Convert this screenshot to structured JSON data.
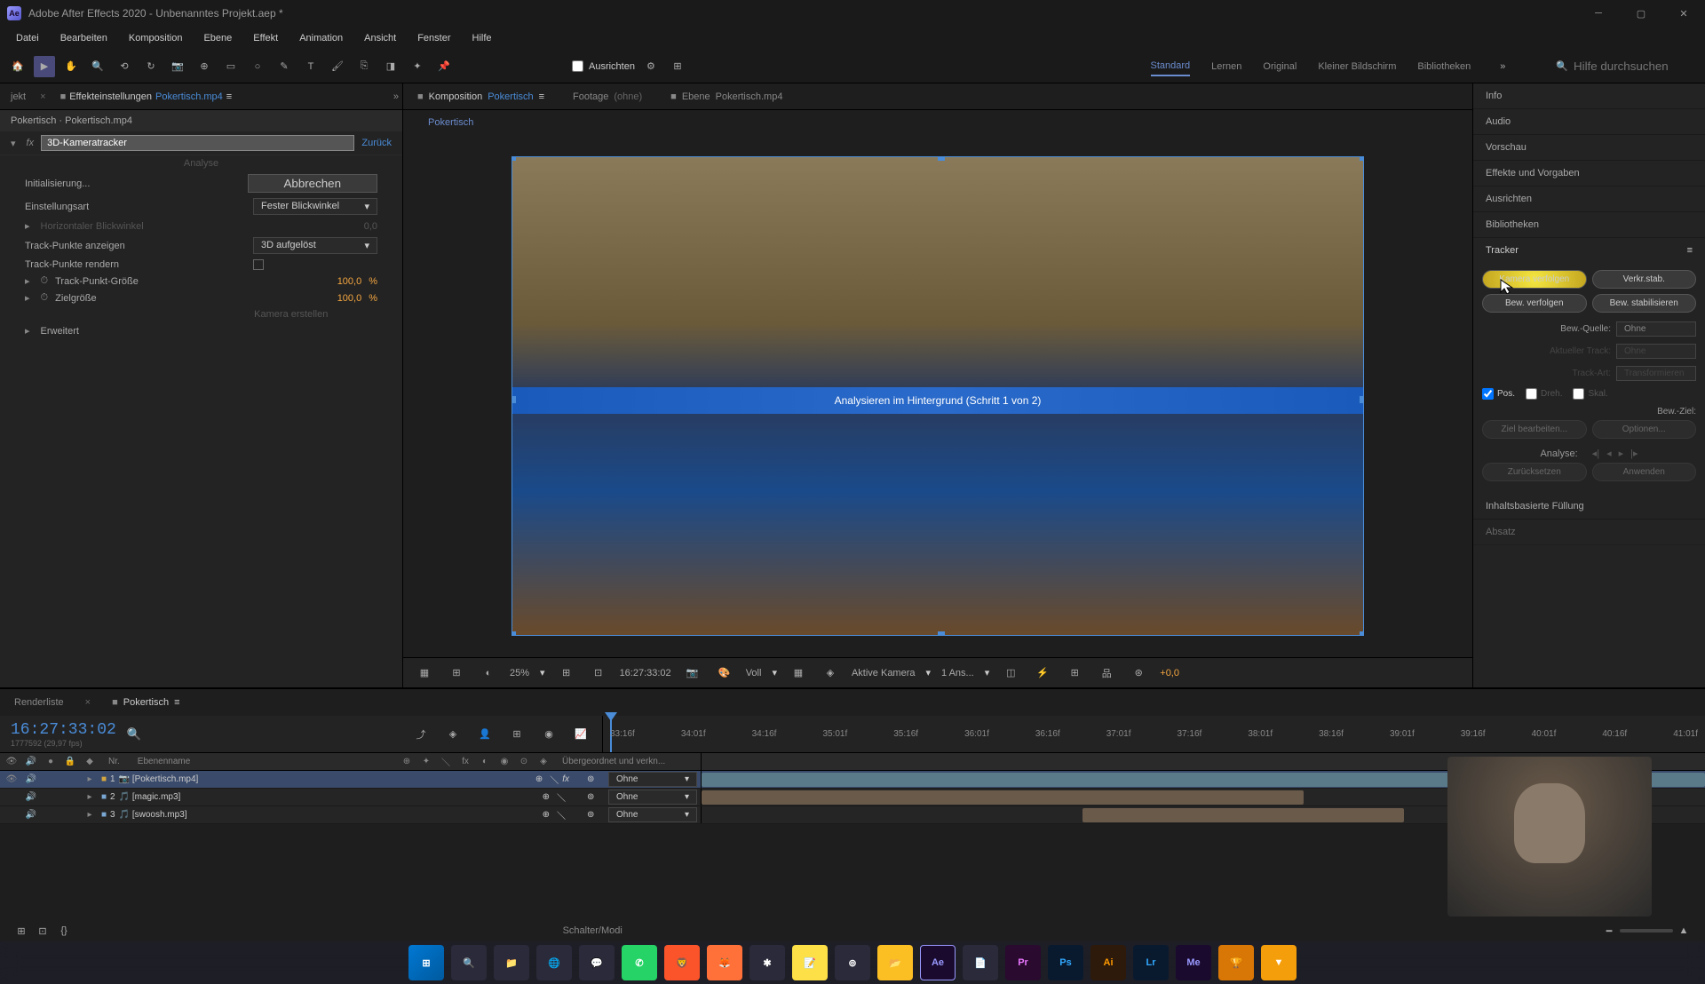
{
  "titlebar": {
    "app_icon": "Ae",
    "title": "Adobe After Effects 2020 - Unbenanntes Projekt.aep *"
  },
  "menubar": [
    "Datei",
    "Bearbeiten",
    "Komposition",
    "Ebene",
    "Effekt",
    "Animation",
    "Ansicht",
    "Fenster",
    "Hilfe"
  ],
  "toolbar": {
    "ausrichten": "Ausrichten",
    "workspaces": [
      "Standard",
      "Lernen",
      "Original",
      "Kleiner Bildschirm",
      "Bibliotheken"
    ],
    "search_placeholder": "Hilfe durchsuchen"
  },
  "left_panel": {
    "tab_prefix": "jekt",
    "tab_label": "Effekteinstellungen",
    "tab_source": "Pokertisch.mp4",
    "breadcrumb": "Pokertisch · Pokertisch.mp4",
    "effect_name": "3D-Kameratracker",
    "reset": "Zurück",
    "analyse": "Analyse",
    "params": {
      "init": "Initialisierung...",
      "cancel": "Abbrechen",
      "einstellungsart": "Einstellungsart",
      "einstellungsart_val": "Fester Blickwinkel",
      "horiz": "Horizontaler Blickwinkel",
      "horiz_val": "0,0",
      "trackpunkte_anzeigen": "Track-Punkte anzeigen",
      "trackpunkte_anzeigen_val": "3D aufgelöst",
      "trackpunkte_rendern": "Track-Punkte rendern",
      "trackpunkt_groesse": "Track-Punkt-Größe",
      "trackpunkt_groesse_val": "100,0",
      "trackpunkt_groesse_unit": "%",
      "zielgroesse": "Zielgröße",
      "zielgroesse_val": "100,0",
      "zielgroesse_unit": "%",
      "kamera_erstellen": "Kamera erstellen",
      "erweitert": "Erweitert"
    }
  },
  "viewer": {
    "tabs": {
      "komposition": "Komposition",
      "komposition_name": "Pokertisch",
      "footage": "Footage",
      "footage_val": "(ohne)",
      "ebene": "Ebene",
      "ebene_name": "Pokertisch.mp4"
    },
    "subtab": "Pokertisch",
    "analysis_text": "Analysieren im Hintergrund (Schritt 1 von 2)",
    "bottom": {
      "zoom": "25%",
      "timecode": "16:27:33:02",
      "quality": "Voll",
      "camera": "Aktive Kamera",
      "views": "1 Ans...",
      "exposure": "+0,0"
    }
  },
  "right_panel": {
    "sections": [
      "Info",
      "Audio",
      "Vorschau",
      "Effekte und Vorgaben",
      "Ausrichten",
      "Bibliotheken"
    ],
    "tracker": {
      "title": "Tracker",
      "kamera_verfolgen": "Kamera verfolgen",
      "verkr_stab": "Verkr.stab.",
      "bew_verfolgen": "Bew. verfolgen",
      "bew_stabilisieren": "Bew. stabilisieren",
      "bew_quelle": "Bew.-Quelle:",
      "bew_quelle_val": "Ohne",
      "aktueller_track": "Aktueller Track:",
      "aktueller_track_val": "Ohne",
      "track_art": "Track-Art:",
      "track_art_val": "Transformieren",
      "pos": "Pos.",
      "dreh": "Dreh.",
      "skal": "Skal.",
      "bew_ziel": "Bew.-Ziel:",
      "ziel_bearbeiten": "Ziel bearbeiten...",
      "optionen": "Optionen...",
      "analyse": "Analyse:",
      "zuruecksetzen": "Zurücksetzen",
      "anwenden": "Anwenden"
    },
    "inhaltsbasierte": "Inhaltsbasierte Füllung",
    "absatz": "Absatz"
  },
  "timeline": {
    "tabs": {
      "renderliste": "Renderliste",
      "comp": "Pokertisch"
    },
    "timecode": "16:27:33:02",
    "subtime": "1777592 (29,97 fps)",
    "columns": {
      "nr": "Nr.",
      "ebenenname": "Ebenenname",
      "uebergeordnet": "Übergeordnet und verkn...",
      "ohne": "Ohne"
    },
    "ruler": [
      "33:16f",
      "34:01f",
      "34:16f",
      "35:01f",
      "35:16f",
      "36:01f",
      "36:16f",
      "37:01f",
      "37:16f",
      "38:01f",
      "38:16f",
      "39:01f",
      "39:16f",
      "40:01f",
      "40:16f",
      "41:01f"
    ],
    "layers": [
      {
        "num": "1",
        "name": "[Pokertisch.mp4]",
        "parent": "Ohne"
      },
      {
        "num": "2",
        "name": "[magic.mp3]",
        "parent": "Ohne"
      },
      {
        "num": "3",
        "name": "[swoosh.mp3]",
        "parent": "Ohne"
      }
    ],
    "footer": "Schalter/Modi"
  }
}
